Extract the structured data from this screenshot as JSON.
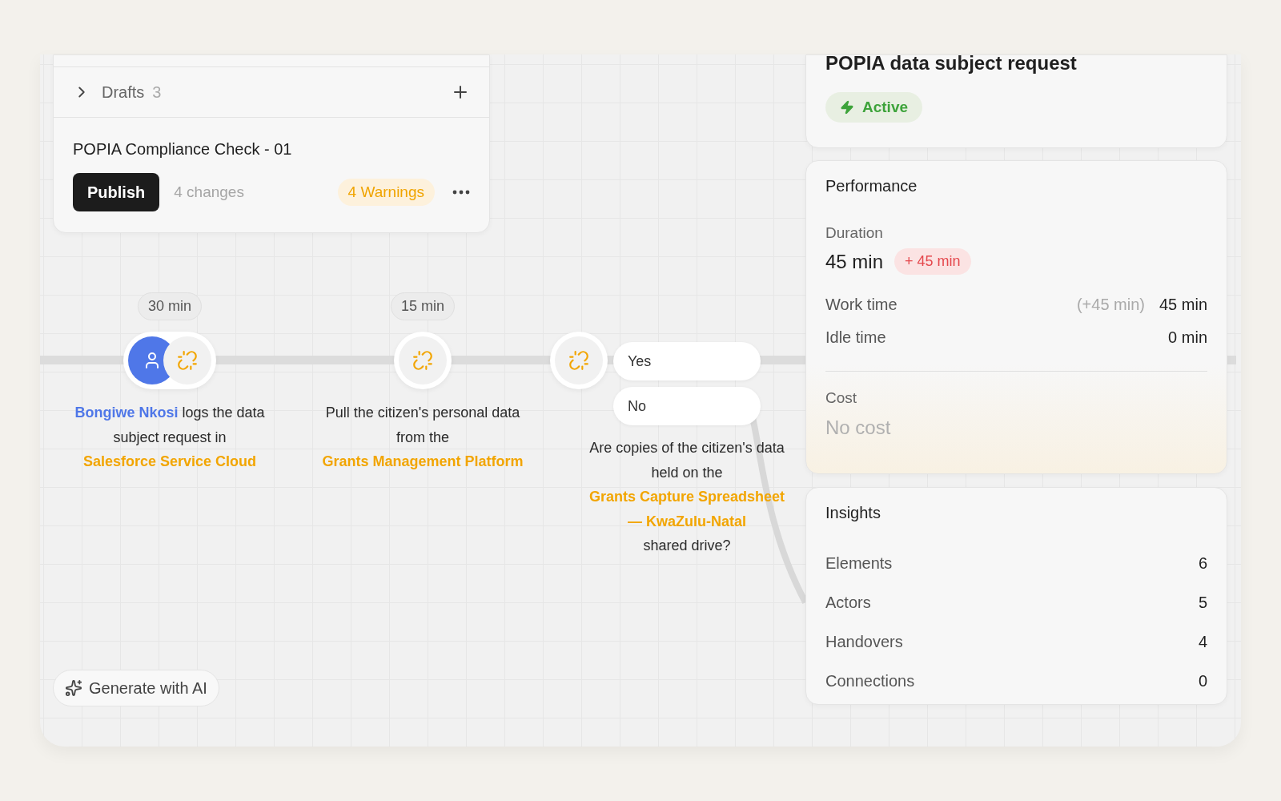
{
  "drafts": {
    "label": "Drafts",
    "count": "3",
    "expanded": false
  },
  "draft": {
    "title": "POPIA Compliance Check - 01",
    "publish": "Publish",
    "changes": "4 changes",
    "warnings": "4 Warnings"
  },
  "steps": [
    {
      "kind": "actor-task",
      "duration": "30 min",
      "text": [
        {
          "kind": "actor",
          "text": "Bongiwe Nkosi"
        },
        {
          "kind": "plain",
          "text": " logs the data subject request in "
        },
        {
          "kind": "system",
          "text": "Salesforce Service Cloud"
        }
      ]
    },
    {
      "kind": "task",
      "duration": "15 min",
      "text": [
        {
          "kind": "plain",
          "text": "Pull the citizen's personal data from the "
        },
        {
          "kind": "system",
          "text": "Grants Management Platform"
        }
      ]
    },
    {
      "kind": "decision",
      "branches": [
        {
          "label": "Yes"
        },
        {
          "label": "No"
        }
      ],
      "text": [
        {
          "kind": "plain",
          "text": "Are copies of the citizen's data held on the "
        },
        {
          "kind": "system",
          "text": "Grants Capture Spreadsheet — KwaZulu-Natal"
        },
        {
          "kind": "plain",
          "text": " shared drive?"
        }
      ]
    }
  ],
  "generate_button": "Generate with AI",
  "process": {
    "title": "POPIA data subject request",
    "status": {
      "label": "Active",
      "kind": "active"
    }
  },
  "performance": {
    "title": "Performance",
    "duration_label": "Duration",
    "duration": "45 min",
    "delta": "+ 45 min",
    "rows": [
      {
        "label": "Work time",
        "note": "(+45 min)",
        "value": "45 min"
      },
      {
        "label": "Idle time",
        "value": "0 min"
      }
    ],
    "cost_label": "Cost",
    "cost": "No cost"
  },
  "insights": {
    "title": "Insights",
    "rows": [
      {
        "label": "Elements",
        "value": "6"
      },
      {
        "label": "Actors",
        "value": "5"
      },
      {
        "label": "Handovers",
        "value": "4"
      },
      {
        "label": "Connections",
        "value": "0"
      }
    ]
  }
}
